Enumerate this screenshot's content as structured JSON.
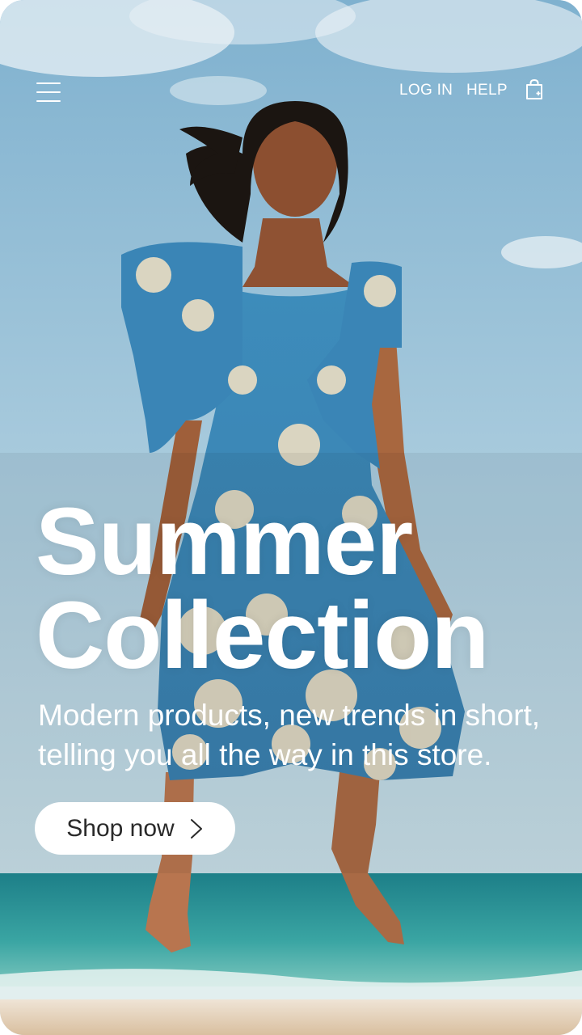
{
  "header": {
    "login_label": "LOG IN",
    "help_label": "HELP"
  },
  "hero": {
    "title_line1": "Summer",
    "title_line2": "Collection",
    "subtitle": "Modern products, new trends in short, telling you all the way in this store.",
    "cta_label": "Shop now"
  },
  "icons": {
    "menu": "hamburger-menu-icon",
    "cart": "shopping-bag-icon",
    "cta_arrow": "chevron-right-icon"
  },
  "colors": {
    "sky": "#9fc4d8",
    "sea": "#2a8f96",
    "sand": "#e6d3bd",
    "dress": "#3f86b5",
    "text": "#ffffff",
    "button_bg": "#ffffff",
    "button_text": "#2a2a2a"
  }
}
